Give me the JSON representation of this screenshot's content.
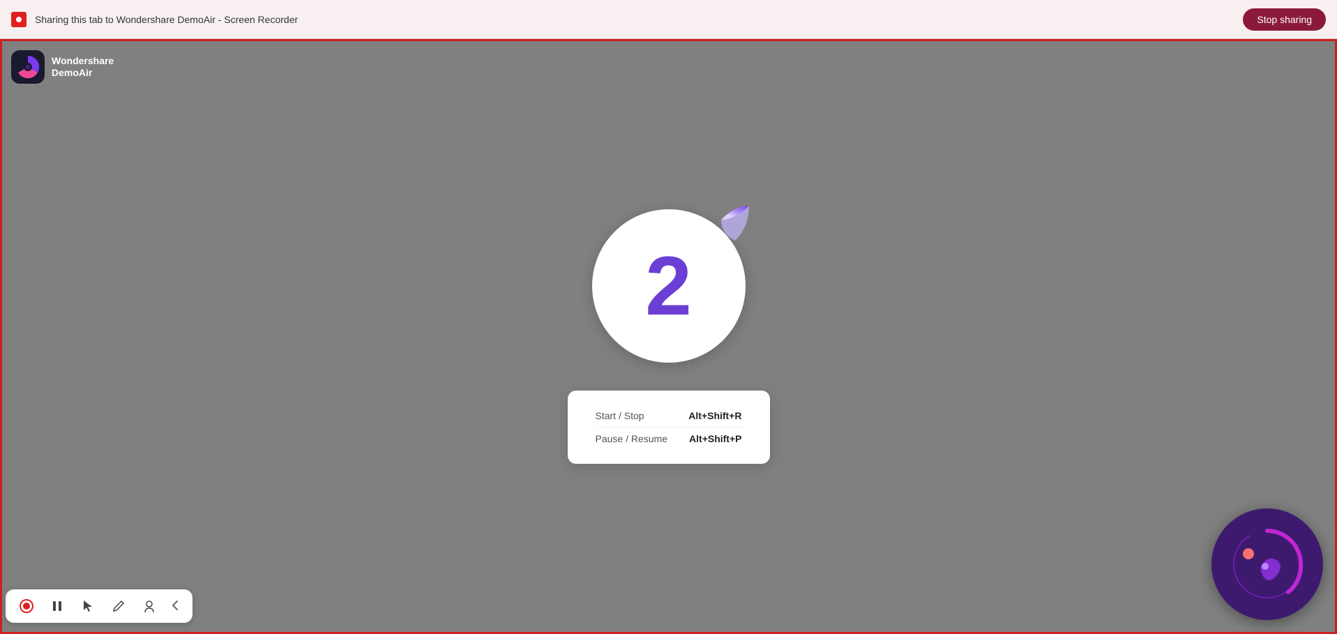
{
  "browser_bar": {
    "sharing_text": "Sharing this tab to Wondershare DemoAir - Screen Recorder",
    "stop_button_label": "Stop sharing"
  },
  "app": {
    "name_line1": "Wondershare",
    "name_line2": "DemoAir"
  },
  "countdown": {
    "number": "2"
  },
  "shortcuts": {
    "rows": [
      {
        "label": "Start / Stop",
        "keys": "Alt+Shift+R"
      },
      {
        "label": "Pause / Resume",
        "keys": "Alt+Shift+P"
      }
    ]
  },
  "toolbar": {
    "buttons": [
      {
        "name": "record-stop",
        "icon": "⏺",
        "label": "Record Stop"
      },
      {
        "name": "pause",
        "icon": "⏸",
        "label": "Pause"
      },
      {
        "name": "cursor",
        "icon": "▷",
        "label": "Cursor"
      },
      {
        "name": "draw",
        "icon": "✏",
        "label": "Draw"
      },
      {
        "name": "annotation",
        "icon": "👤",
        "label": "Annotation"
      },
      {
        "name": "collapse",
        "icon": "‹",
        "label": "Collapse"
      }
    ]
  }
}
